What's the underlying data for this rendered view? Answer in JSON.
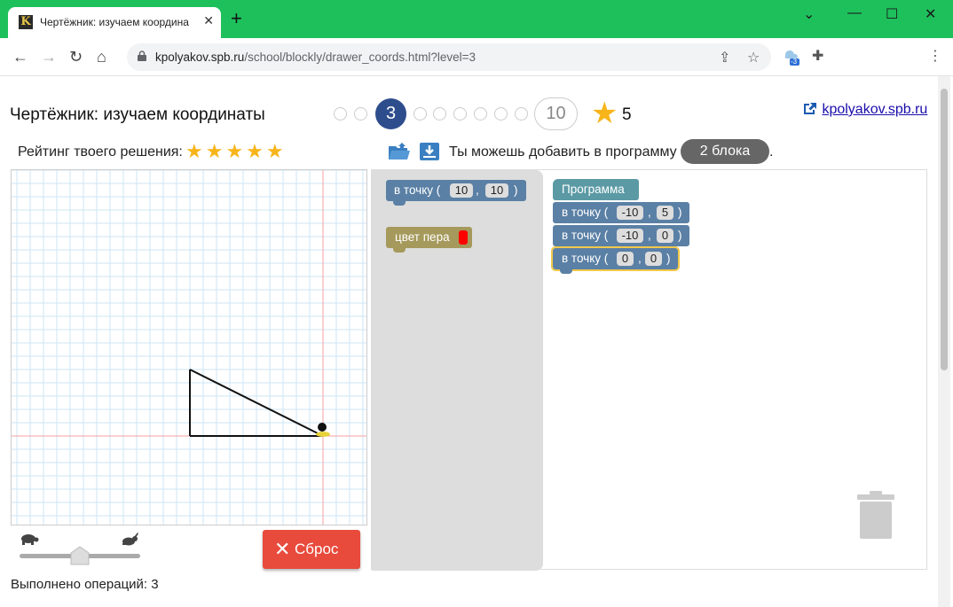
{
  "browser": {
    "tab_title": "Чертёжник: изучаем координа",
    "favicon_letter": "K",
    "url_host": "kpolyakov.spb.ru",
    "url_path": "/school/blockly/drawer_coords.html?level=3",
    "extension_badge": "-3",
    "icons": [
      "back-icon",
      "forward-icon",
      "reload-icon",
      "home-icon",
      "lock-icon",
      "share-icon",
      "bookmark-star-icon",
      "extension-icon",
      "puzzle-icon",
      "menu-icon",
      "minimize-icon",
      "maximize-icon",
      "close-icon"
    ]
  },
  "header": {
    "title": "Чертёжник: изучаем координаты",
    "current_level": "3",
    "max_level": "10",
    "stars": "5",
    "site_link": "kpolyakov.spb.ru"
  },
  "rating": {
    "label": "Рейтинг твоего решения:",
    "stars": "★★★★★",
    "value": 5
  },
  "toolbox": {
    "add_text": "Ты можешь добавить в программу",
    "blocks_left": "2 блока",
    "after": "."
  },
  "flyout_blocks": [
    {
      "label": "в точку (",
      "sep": ",",
      "close": ")",
      "x": "10",
      "y": "10"
    },
    {
      "label": "цвет пера",
      "color": "#ff0000"
    }
  ],
  "program": {
    "header": "Программа",
    "blocks": [
      {
        "label": "в точку (",
        "sep": ",",
        "close": ")",
        "x": "-10",
        "y": "5"
      },
      {
        "label": "в точку (",
        "sep": ",",
        "close": ")",
        "x": "-10",
        "y": "0"
      },
      {
        "label": "в точку (",
        "sep": ",",
        "close": ")",
        "x": "0",
        "y": "0"
      }
    ]
  },
  "controls": {
    "reset_label": "Сброс",
    "speed": 0.5
  },
  "status": {
    "ops_label": "Выполнено операций: 3"
  },
  "colors": {
    "chrome": "#1ec05c",
    "accent": "#2e4d8c",
    "star": "#f7b51b",
    "reset": "#e84a3c",
    "move_block": "#5b80a5",
    "pen_block": "#a5995b",
    "program_block": "#5b9aa5"
  },
  "drawing": {
    "segments": [
      {
        "from": [
          0,
          0
        ],
        "to": [
          -10,
          5
        ]
      },
      {
        "from": [
          -10,
          5
        ],
        "to": [
          -10,
          0
        ]
      },
      {
        "from": [
          -10,
          0
        ],
        "to": [
          0,
          0
        ]
      }
    ],
    "drawer_at": [
      0,
      0
    ]
  }
}
